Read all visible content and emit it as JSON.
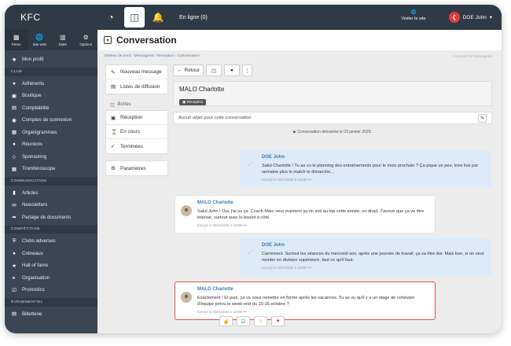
{
  "app": {
    "brand": "KFC",
    "online": "En ligne (0)",
    "visit": "Visiter le site",
    "user": "DOE John"
  },
  "modules": [
    {
      "label": "Perso",
      "icon": "user-icon"
    },
    {
      "label": "Site web",
      "icon": "globe-icon"
    },
    {
      "label": "Stats",
      "icon": "chart-icon"
    },
    {
      "label": "Options",
      "icon": "gears-icon"
    }
  ],
  "sidebar": {
    "profile": "Mon profil",
    "club_title": "CLUB",
    "club": [
      "Adhérents",
      "Boutique",
      "Comptabilité",
      "Comptes de connexion",
      "Organigrammes",
      "Réunions",
      "Sponsoring",
      "Trombinoscope"
    ],
    "comm_title": "COMMUNICATION",
    "comm": [
      "Articles",
      "Newsletters",
      "Partage de documents"
    ],
    "comp_title": "COMPÉTITION",
    "comp": [
      "Clubs adverses",
      "Créneaux",
      "Hall of fame",
      "Organisation",
      "Pronostics"
    ],
    "event_title": "ÉVÉNEMENTIEL",
    "event": [
      "Billetterie"
    ]
  },
  "page": {
    "title": "Conversation"
  },
  "breadcrumb": {
    "home": "Tableau de bord",
    "s1": "Messagerie",
    "s2": "Réception",
    "current": "Conversation",
    "right": "À propos de Messagerie"
  },
  "leftmenu": {
    "new": "Nouveau message",
    "lists": "Listes de diffusion",
    "boxes_label": "Boîtes",
    "inbox": "Réception",
    "ongoing": "En cours",
    "done": "Terminées",
    "settings": "Paramètres"
  },
  "toolbar": {
    "back": "Retour"
  },
  "conversation": {
    "name": "MALO Charlotte",
    "badge": "Réception",
    "subject_empty": "Aucun objet pour cette conversation",
    "started": "Conversation démarrée le 03 janvier 2025."
  },
  "messages": [
    {
      "author": "DOE John",
      "text": "Salut Charlotte ! Tu as vu le planning des entraînements pour le mois prochain ? Ça pique un peu, trois fois par semaine plus le match le dimanche...",
      "sent": "Envoyé le 03/01/2025 à 10H30 •••"
    },
    {
      "author": "MALO Charlotte",
      "text": "Salut John ! Oui, j'ai vu ça. Coach Marc veut vraiment qu'on soit au top cette année, on dirait. J'avoue que ça va être intense, surtout avec le boulot à côté.",
      "sent": "Envoyé le 03/01/2025 à 10H55 •••"
    },
    {
      "author": "DOE John",
      "text": "Carrément. Surtout les séances du mercredi soir, après une journée de travail, ça va être dur. Mais bon, si on veut monter en division supérieure, faut ce qu'il faut.",
      "sent": "Envoyé le 03/01/2025 à 10H53 •••"
    },
    {
      "author": "MALO Charlotte",
      "text": "Exactement ! Et puis, ça va nous remettre en forme après les vacances. Tu as vu qu'il y a un stage de cohésion d'équipe prévu le week-end du 15-16 octobre ?",
      "sent": "Envoyé le 03/01/2025 à 11H00 •••"
    }
  ],
  "reactions": [
    "thumbs-up-icon",
    "check-icon",
    "smile-icon",
    "heart-icon"
  ]
}
